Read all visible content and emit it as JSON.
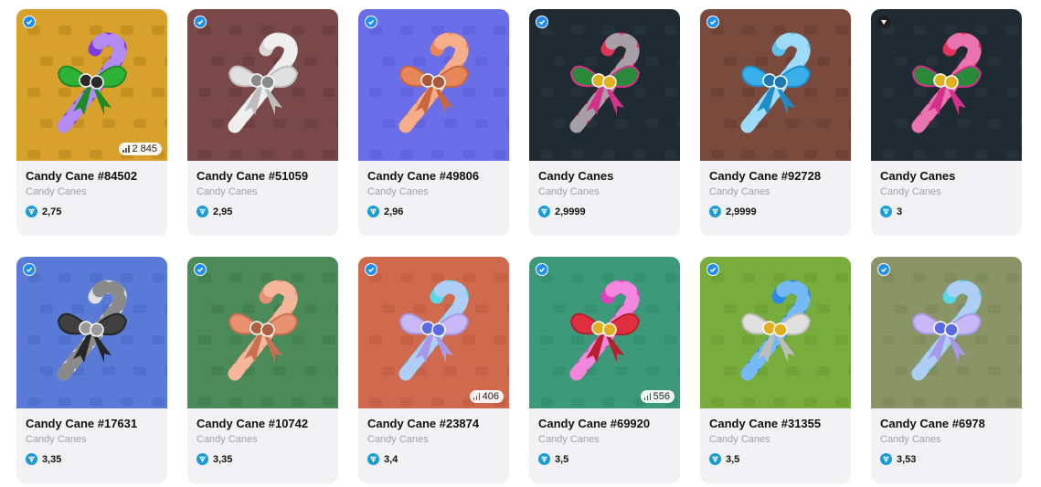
{
  "cards": [
    {
      "title": "Candy Cane #84502",
      "collection": "Candy Canes",
      "price": "2,75",
      "count": "2 845",
      "badge": "blue",
      "bg": "#d7a12c",
      "pat": "#b8841a",
      "cane": "#7a3be0",
      "stripe": "#d9c3ff",
      "bow": "#2fb238",
      "bow2": "#1f8a28",
      "center": "#2a2a2a"
    },
    {
      "title": "Candy Cane #51059",
      "collection": "Candy Canes",
      "price": "2,95",
      "count": "",
      "badge": "blue",
      "bg": "#7a4848",
      "pat": "#663a3a",
      "cane": "#d8d8d8",
      "stripe": "#ffffff",
      "bow": "#e0e0e0",
      "bow2": "#bdbdbd",
      "center": "#8a8a8a"
    },
    {
      "title": "Candy Cane #49806",
      "collection": "Candy Canes",
      "price": "2,96",
      "count": "",
      "badge": "blue",
      "bg": "#6a6ee8",
      "pat": "#595dd6",
      "cane": "#e8865a",
      "stripe": "#ffc8a8",
      "bow": "#e8865a",
      "bow2": "#c9683f",
      "center": "#a85a3a"
    },
    {
      "title": "Candy Canes",
      "collection": "Candy Canes",
      "price": "2,9999",
      "count": "",
      "badge": "blue",
      "bg": "#1f2a33",
      "pat": "#2b3742",
      "cane": "#e0345a",
      "stripe": "#7fe8d8",
      "bow": "#2a8a3a",
      "bow2": "#d4328a",
      "center": "#e0b020"
    },
    {
      "title": "Candy Cane #92728",
      "collection": "Candy Canes",
      "price": "2,9999",
      "count": "",
      "badge": "blue",
      "bg": "#7a4a3c",
      "pat": "#673d31",
      "cane": "#5ec0f0",
      "stripe": "#c8ecff",
      "bow": "#3aaee8",
      "bow2": "#1f8cc8",
      "center": "#1f7ab0"
    },
    {
      "title": "Candy Canes",
      "collection": "Candy Canes",
      "price": "3",
      "count": "",
      "badge": "dark",
      "bg": "#1f2a33",
      "pat": "#2b3742",
      "cane": "#e0345a",
      "stripe": "#f0a0e8",
      "bow": "#2a8a3a",
      "bow2": "#d4328a",
      "center": "#e0b020"
    },
    {
      "title": "Candy Cane #17631",
      "collection": "Candy Canes",
      "price": "3,35",
      "count": "",
      "badge": "blue",
      "bg": "#5a7ad8",
      "pat": "#4a68c4",
      "cane": "#e0e0e0",
      "stripe": "#505050",
      "bow": "#404040",
      "bow2": "#262626",
      "center": "#9a9a9a"
    },
    {
      "title": "Candy Cane #10742",
      "collection": "Candy Canes",
      "price": "3,35",
      "count": "",
      "badge": "blue",
      "bg": "#4c8a5a",
      "pat": "#3f7a4c",
      "cane": "#e89070",
      "stripe": "#ffd0b8",
      "bow": "#e89070",
      "bow2": "#c87050",
      "center": "#b06040"
    },
    {
      "title": "Candy Cane #23874",
      "collection": "Candy Canes",
      "price": "3,4",
      "count": "406",
      "badge": "blue",
      "bg": "#d06a4e",
      "pat": "#bd5a40",
      "cane": "#58d8e8",
      "stripe": "#e8c8ff",
      "bow": "#c8b8f8",
      "bow2": "#a898e8",
      "center": "#5a6ae0"
    },
    {
      "title": "Candy Cane #69920",
      "collection": "Candy Canes",
      "price": "3,5",
      "count": "556",
      "badge": "blue",
      "bg": "#3c9a7a",
      "pat": "#328a6b",
      "cane": "#e040c0",
      "stripe": "#ffb8f0",
      "bow": "#e03040",
      "bow2": "#b81e2e",
      "center": "#e0b020"
    },
    {
      "title": "Candy Cane #31355",
      "collection": "Candy Canes",
      "price": "3,5",
      "count": "",
      "badge": "blue",
      "bg": "#78ac3c",
      "pat": "#6a9c30",
      "cane": "#2a8ae8",
      "stripe": "#a8d8ff",
      "bow": "#e0e0e0",
      "bow2": "#bdbdbd",
      "center": "#e0b020"
    },
    {
      "title": "Candy Cane #6978",
      "collection": "Candy Canes",
      "price": "3,53",
      "count": "",
      "badge": "blue",
      "bg": "#8a9466",
      "pat": "#7a8458",
      "cane": "#58d8e8",
      "stripe": "#e8c8ff",
      "bow": "#c8b8f8",
      "bow2": "#a898e8",
      "center": "#5a6ae0"
    }
  ]
}
